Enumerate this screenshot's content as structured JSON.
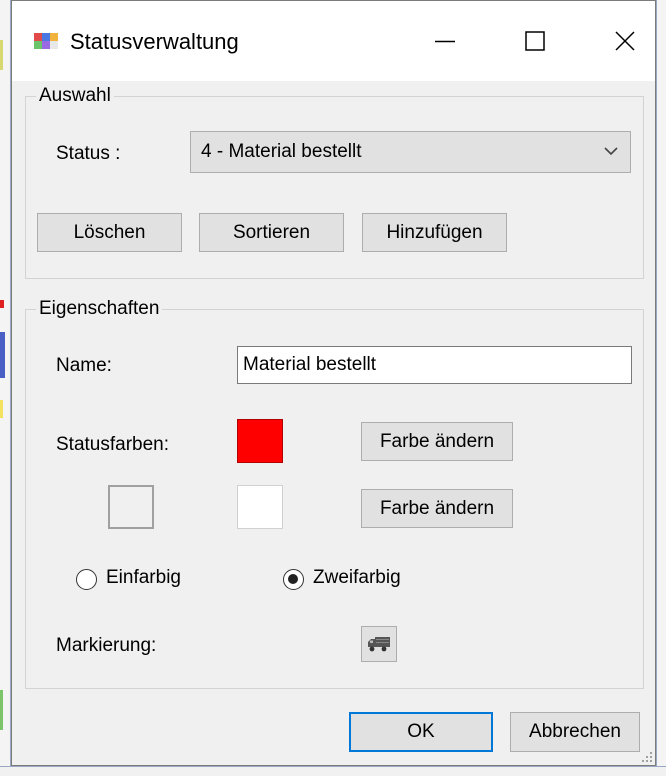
{
  "window": {
    "title": "Statusverwaltung",
    "controls": {
      "minimize": "minimize-icon",
      "maximize": "maximize-icon",
      "close": "close-icon"
    }
  },
  "auswahl": {
    "legend": "Auswahl",
    "status_label": "Status :",
    "status_value": "4 - Material bestellt",
    "buttons": {
      "delete": "Löschen",
      "sort": "Sortieren",
      "add": "Hinzufügen"
    }
  },
  "eigenschaften": {
    "legend": "Eigenschaften",
    "name_label": "Name:",
    "name_value": "Material bestellt",
    "statusfarben_label": "Statusfarben:",
    "color1": "#ff0000",
    "color2": "#ffffff",
    "change_color_1": "Farbe ändern",
    "change_color_2": "Farbe ändern",
    "radio_einfarbig": "Einfarbig",
    "radio_zweifarbig": "Zweifarbig",
    "selected_mode": "Zweifarbig",
    "markierung_label": "Markierung:",
    "markierung_icon": "truck-icon"
  },
  "footer": {
    "ok": "OK",
    "cancel": "Abbrechen"
  },
  "colors": {
    "accent": "#0078d7",
    "dialog_bg": "#f0f0f0"
  }
}
